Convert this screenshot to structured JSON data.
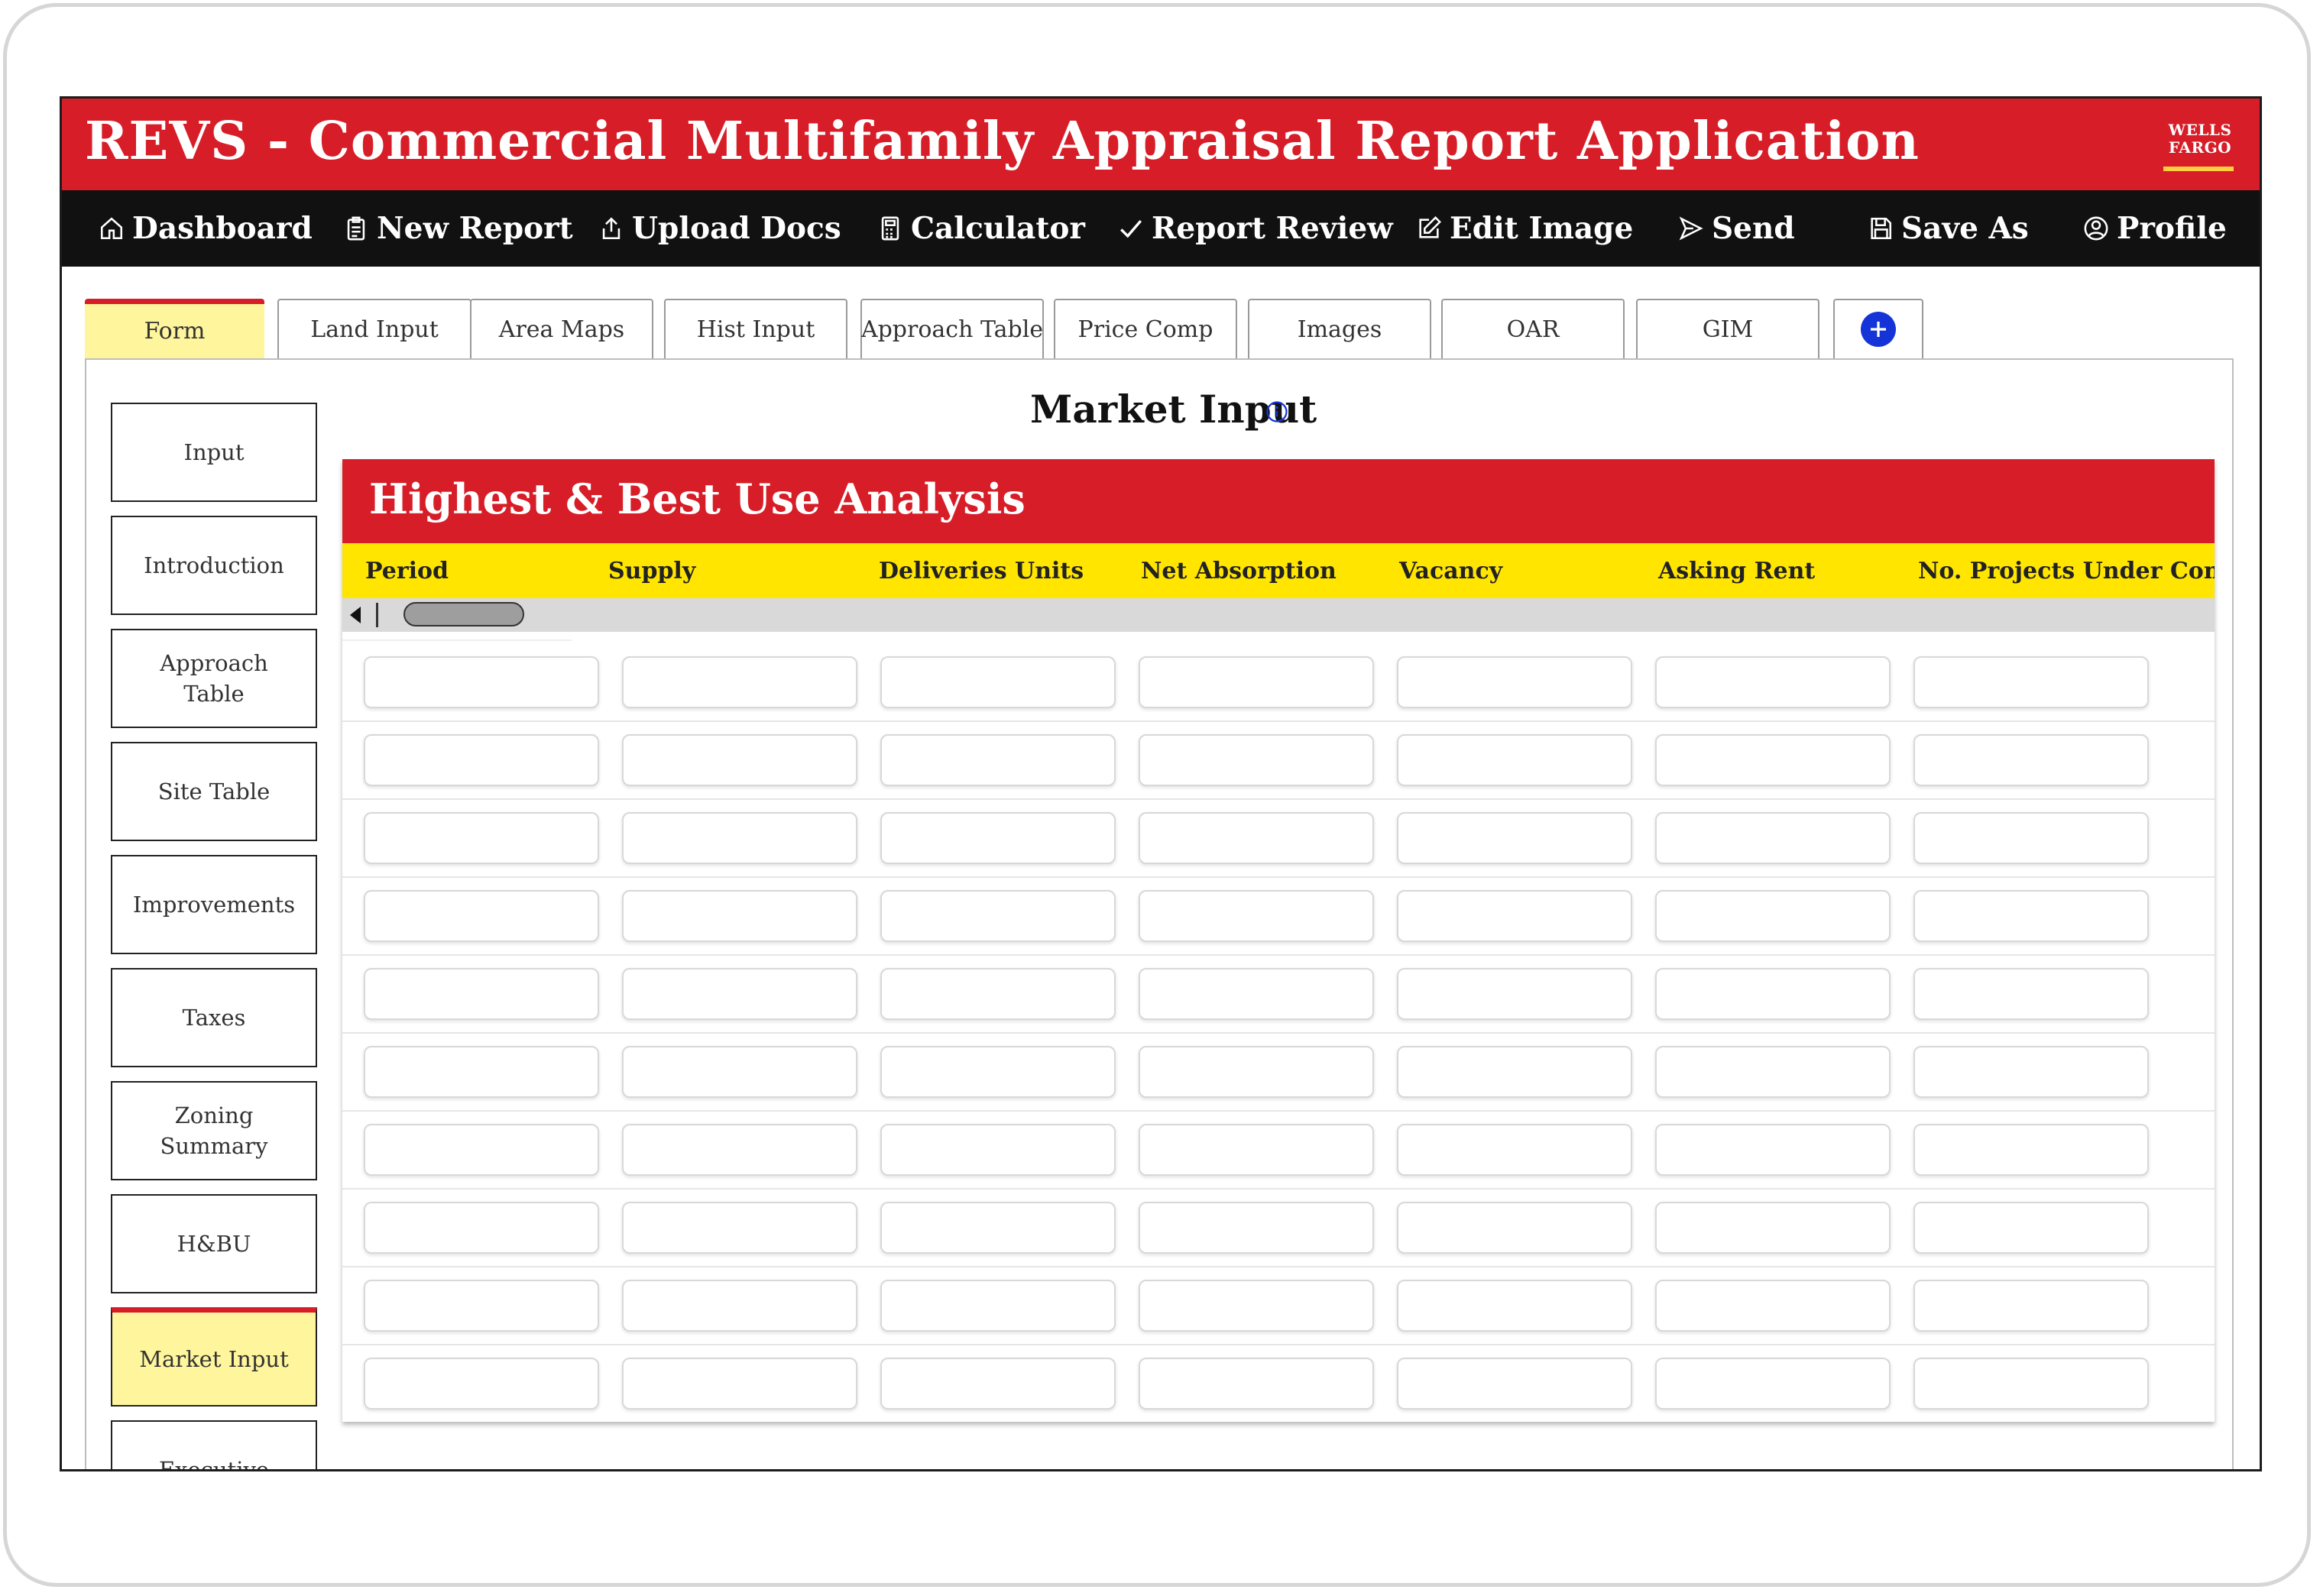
{
  "app": {
    "title": "REVS - Commercial Multifamily Appraisal Report Application",
    "logo_line1": "WELLS",
    "logo_line2": "FARGO"
  },
  "colors": {
    "brand_red": "#d71e28",
    "nav_bg": "#111111",
    "header_yellow": "#ffe500",
    "active_tab": "#fff59d",
    "accent_blue": "#1534d8"
  },
  "nav": [
    {
      "label": "Dashboard",
      "icon": "home-icon"
    },
    {
      "label": "New Report",
      "icon": "clipboard-icon"
    },
    {
      "label": "Upload Docs",
      "icon": "upload-icon"
    },
    {
      "label": "Calculator",
      "icon": "calculator-icon"
    },
    {
      "label": "Report Review",
      "icon": "checkmark-icon"
    },
    {
      "label": "Edit Image",
      "icon": "edit-icon"
    },
    {
      "label": "Send",
      "icon": "send-icon"
    },
    {
      "label": "Save As",
      "icon": "save-icon"
    },
    {
      "label": "Profile",
      "icon": "profile-icon"
    }
  ],
  "tabs": [
    {
      "label": "Form",
      "active": true
    },
    {
      "label": "Land Input"
    },
    {
      "label": "Area Maps"
    },
    {
      "label": "Hist Input"
    },
    {
      "label": "Approach Table"
    },
    {
      "label": "Price Comp"
    },
    {
      "label": "Images"
    },
    {
      "label": "OAR"
    },
    {
      "label": "GIM"
    }
  ],
  "sidebar": [
    {
      "label": "Input"
    },
    {
      "label": "Introduction"
    },
    {
      "label": "Approach\nTable"
    },
    {
      "label": "Site Table"
    },
    {
      "label": "Improvements"
    },
    {
      "label": "Taxes"
    },
    {
      "label": "Zoning\nSummary"
    },
    {
      "label": "H&BU"
    },
    {
      "label": "Market Input",
      "active": true
    },
    {
      "label": "Executive"
    }
  ],
  "main": {
    "page_title": "Market Input",
    "section_title": "Highest & Best Use Analysis",
    "columns": [
      "Period",
      "Supply",
      "Deliveries Units",
      "Net Absorption",
      "Vacancy",
      "Asking Rent",
      "No. Projects Under Construction"
    ],
    "row_count": 10
  }
}
